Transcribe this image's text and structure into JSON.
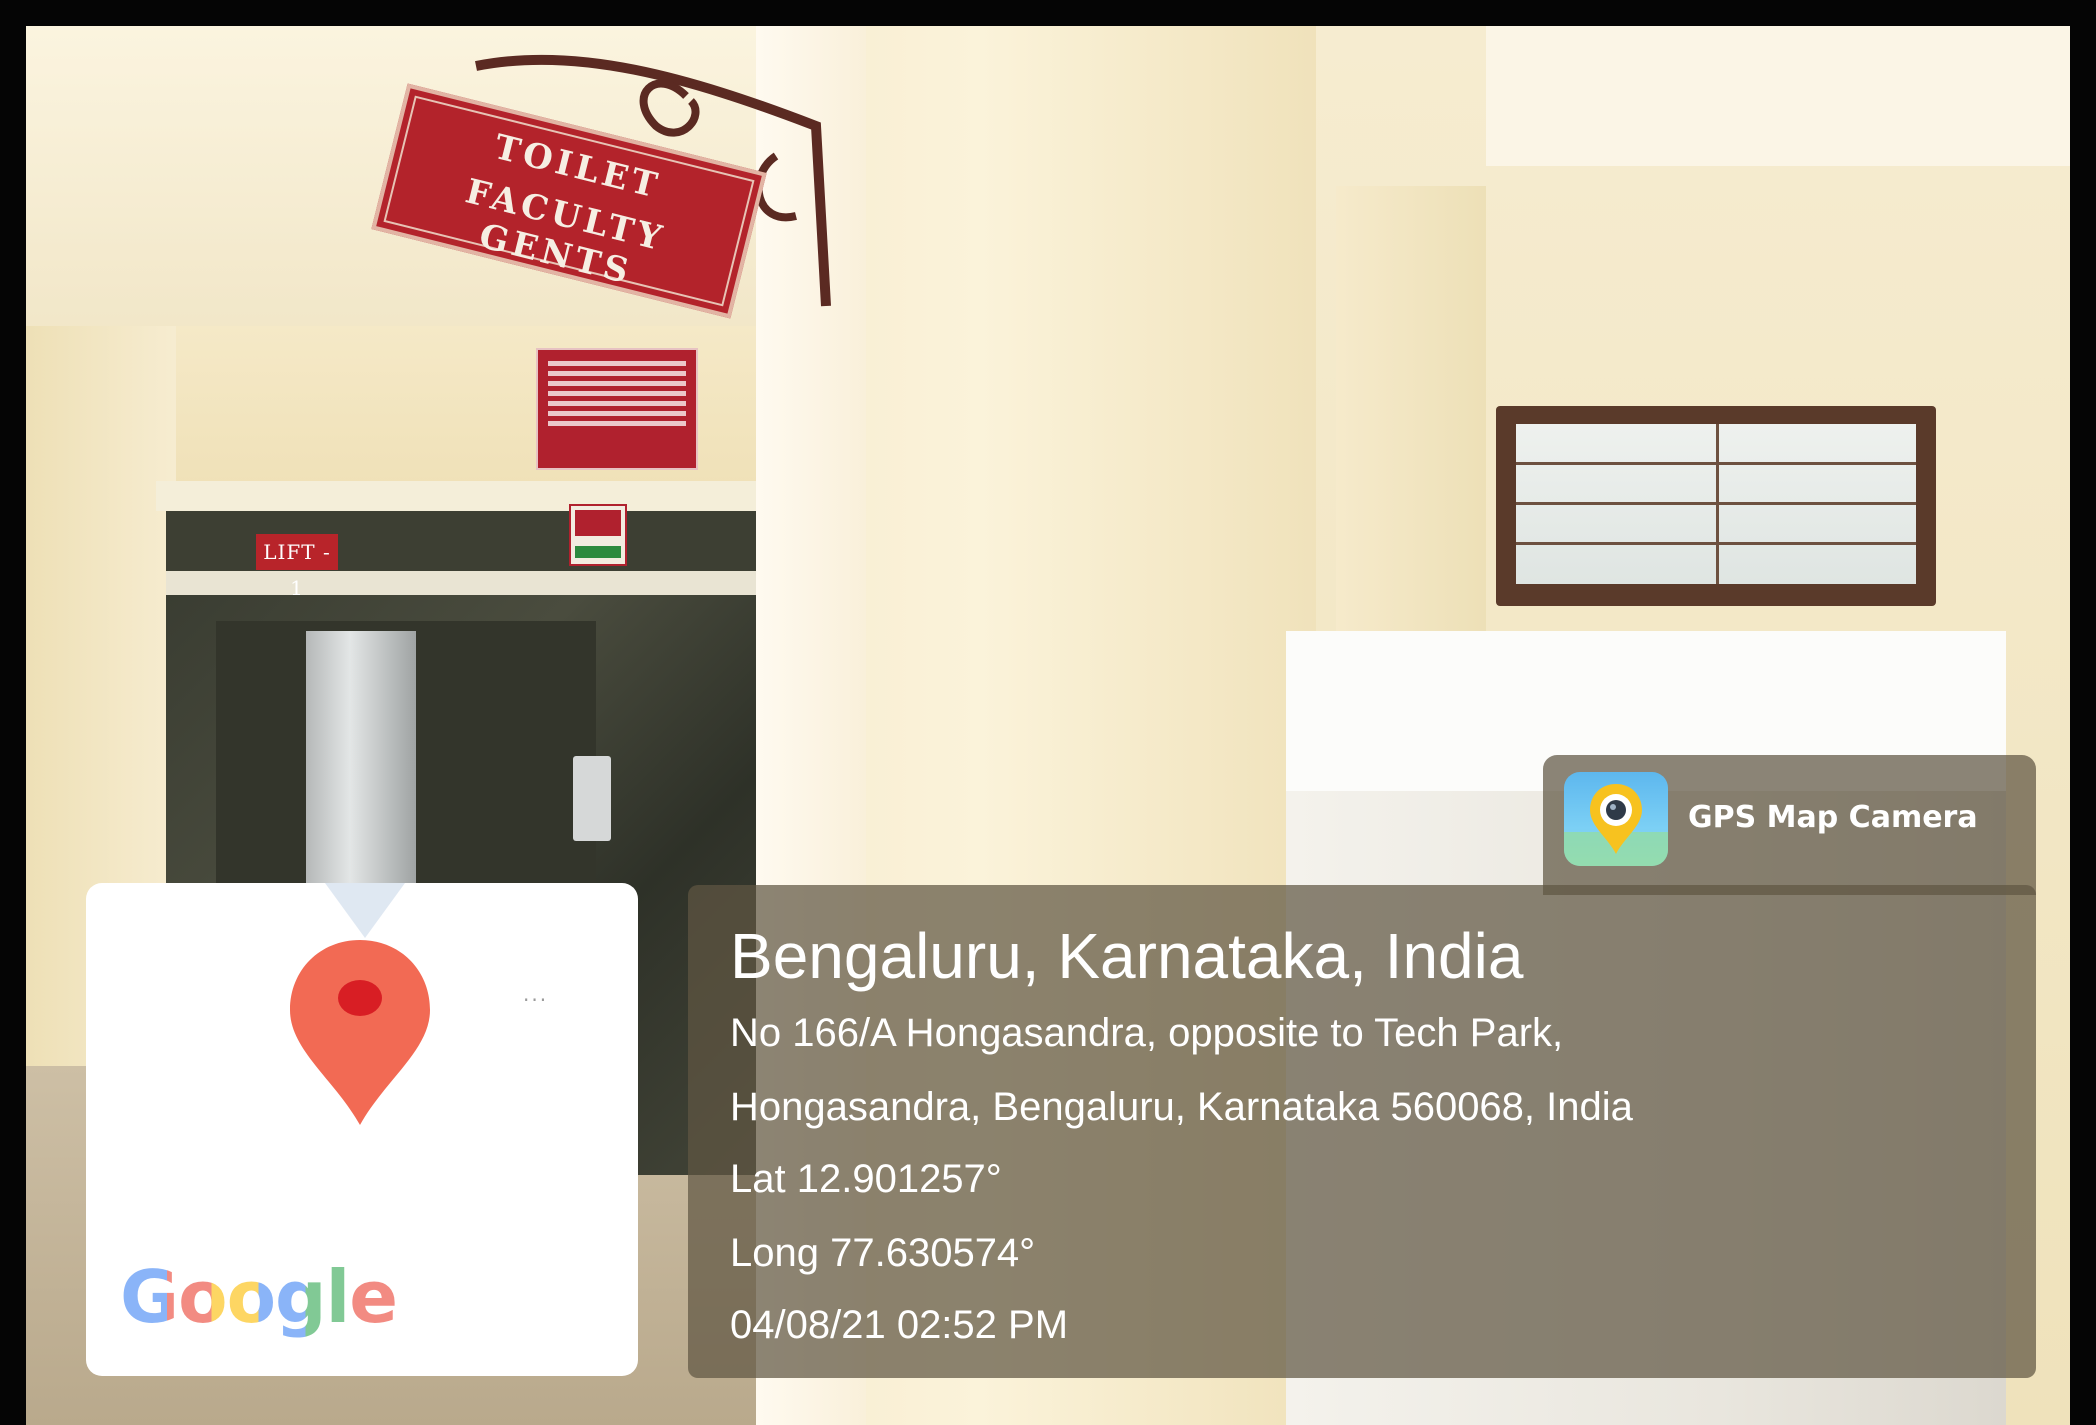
{
  "signage": {
    "hanging_line_1": "TOILET",
    "hanging_line_2": "FACULTY GENTS",
    "lift_label": "LIFT - 1"
  },
  "overlay": {
    "brand_name": "GPS Map Camera",
    "location_title": "Bengaluru, Karnataka, India",
    "address_line_1": "No 166/A Hongasandra, opposite to Tech Park,",
    "address_line_2": "Hongasandra, Bengaluru, Karnataka 560068, India",
    "latitude": "Lat 12.901257°",
    "longitude": "Long 77.630574°",
    "timestamp": "04/08/21 02:52 PM",
    "map_logo": "Google",
    "icons": [
      "map-pin-icon",
      "gps-camera-app-icon"
    ],
    "colors": {
      "panel": "#605642",
      "pin": "#f26a54",
      "pin_dot": "#d81e24",
      "sign_red": "#b3232b"
    }
  }
}
